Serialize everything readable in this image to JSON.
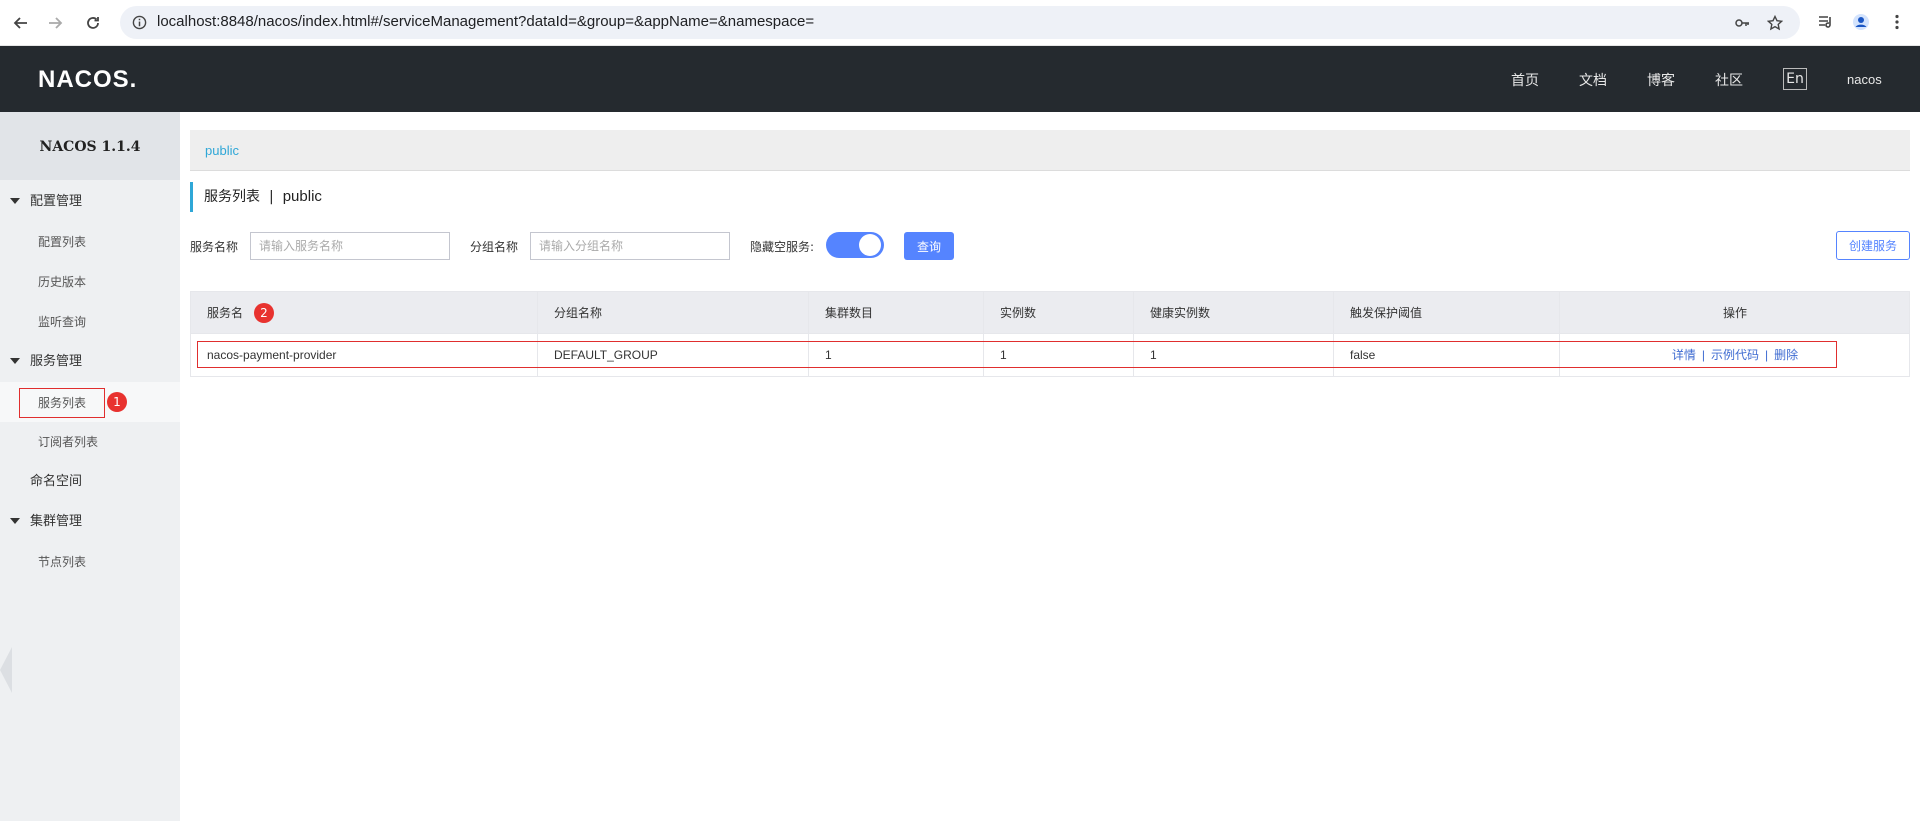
{
  "browser": {
    "url": "localhost:8848/nacos/index.html#/serviceManagement?dataId=&group=&appName=&namespace=",
    "back_icon": "arrow-left-icon",
    "forward_icon": "arrow-right-icon",
    "reload_icon": "reload-icon"
  },
  "header": {
    "logo": "NACOS.",
    "nav": [
      "首页",
      "文档",
      "博客",
      "社区"
    ],
    "lang": "En",
    "user": "nacos"
  },
  "sidebar": {
    "version": "NACOS 1.1.4",
    "groups": [
      {
        "label": "配置管理",
        "items": [
          "配置列表",
          "历史版本",
          "监听查询"
        ]
      },
      {
        "label": "服务管理",
        "items": [
          "服务列表",
          "订阅者列表"
        ]
      },
      {
        "label": "命名空间"
      },
      {
        "label": "集群管理",
        "items": [
          "节点列表"
        ]
      }
    ],
    "active_badge": "1"
  },
  "main": {
    "namespace_tab": "public",
    "title": "服务列表",
    "title_sep": "|",
    "title_ns": "public",
    "form": {
      "service_label": "服务名称",
      "service_placeholder": "请输入服务名称",
      "group_label": "分组名称",
      "group_placeholder": "请输入分组名称",
      "hide_empty_label": "隐藏空服务:",
      "hide_empty_on": true,
      "query_button": "查询",
      "create_button": "创建服务"
    },
    "table": {
      "headers": [
        "服务名",
        "分组名称",
        "集群数目",
        "实例数",
        "健康实例数",
        "触发保护阈值",
        "操作"
      ],
      "header_badge": "2",
      "rows": [
        {
          "service": "nacos-payment-provider",
          "group": "DEFAULT_GROUP",
          "clusters": "1",
          "instances": "1",
          "healthy": "1",
          "protect": "false",
          "actions": [
            "详情",
            "示例代码",
            "删除"
          ],
          "action_sep": "|"
        }
      ]
    }
  },
  "colors": {
    "header_bg": "#252a2f",
    "accent": "#5584ff",
    "highlight_red": "#e02e2e",
    "link": "#3e6bd1"
  }
}
